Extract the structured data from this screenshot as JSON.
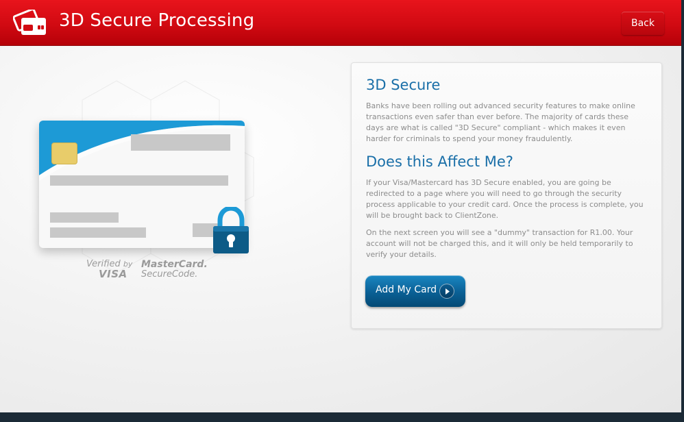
{
  "header": {
    "title": "3D Secure Processing",
    "back_label": "Back",
    "icon": "credit-cards-icon",
    "accent_color": "#d10a12"
  },
  "illustration": {
    "verified_line1": "Verified",
    "verified_by": "by",
    "verified_line2": "VISA",
    "mastercard_line1": "MasterCard.",
    "mastercard_line2": "SecureCode."
  },
  "info": {
    "heading1": "3D Secure",
    "paragraph1": "Banks have been rolling out advanced security features to make online transactions even safer than ever before. The majority of cards these days are what is called \"3D Secure\" compliant - which makes it even harder for criminals to spend your money fraudulently.",
    "heading2": "Does this Affect Me?",
    "paragraph2": "If your Visa/Mastercard has 3D Secure enabled, you are going be redirected to a page where you will need to go through the security process applicable to your credit card. Once the process is complete, you will be brought back to ClientZone.",
    "paragraph3": "On the next screen you will see a \"dummy\" transaction for R1.00. Your account will not be charged this, and it will only be held temporarily to verify your details.",
    "button_label": "Add My Card",
    "heading_color": "#1a6fa8",
    "button_color": "#0a5f94"
  }
}
